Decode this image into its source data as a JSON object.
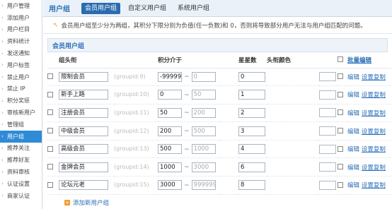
{
  "sidebar": {
    "items": [
      {
        "label": "用户管理",
        "active": false
      },
      {
        "label": "添加用户",
        "active": false
      },
      {
        "label": "用户栏目",
        "active": false
      },
      {
        "label": "资料统计",
        "active": false
      },
      {
        "label": "发送通知",
        "active": false
      },
      {
        "label": "用户标签",
        "active": false
      },
      {
        "label": "禁止用户",
        "active": false
      },
      {
        "label": "禁止 IP",
        "active": false
      },
      {
        "label": "积分奖惩",
        "active": false
      },
      {
        "label": "审核新用户",
        "active": false
      },
      {
        "label": "管理组",
        "active": false
      },
      {
        "label": "用户组",
        "active": true
      },
      {
        "label": "推荐关注",
        "active": false
      },
      {
        "label": "推荐好友",
        "active": false
      },
      {
        "label": "资料审核",
        "active": false
      },
      {
        "label": "认证设置",
        "active": false
      },
      {
        "label": "商家认证",
        "active": false
      }
    ]
  },
  "header": {
    "title": "用户组",
    "tabs": [
      {
        "label": "会员用户组",
        "active": true
      },
      {
        "label": "自定义用户组",
        "active": false
      },
      {
        "label": "系统用户组",
        "active": false
      }
    ]
  },
  "tip": {
    "icon": "hint-icon",
    "text": "会员用户组至少分为两组，其积分下限分别为负值(任一负数)和 0，否则将导致部分用户无法与用户组匹配的问题。"
  },
  "section": {
    "title": "会员用户组",
    "columns": {
      "name": "组头衔",
      "credits": "积分介于",
      "stars": "星星数",
      "color": "头衔颜色",
      "batch": "批量编辑"
    },
    "rows": [
      {
        "name": "限制会员",
        "gid": "(groupid:9)",
        "low": "-99999",
        "high": "0",
        "stars": "0",
        "edit": "编辑",
        "perm": "设置复制"
      },
      {
        "name": "新手上路",
        "gid": "(groupid:10)",
        "low": "0",
        "high": "50",
        "stars": "1",
        "edit": "编辑",
        "perm": "设置复制"
      },
      {
        "name": "注册会员",
        "gid": "(groupid:11)",
        "low": "50",
        "high": "200",
        "stars": "2",
        "edit": "编辑",
        "perm": "设置复制"
      },
      {
        "name": "中级会员",
        "gid": "(groupid:12)",
        "low": "200",
        "high": "500",
        "stars": "3",
        "edit": "编辑",
        "perm": "设置复制"
      },
      {
        "name": "高级会员",
        "gid": "(groupid:13)",
        "low": "500",
        "high": "1000",
        "stars": "4",
        "edit": "编辑",
        "perm": "设置复制"
      },
      {
        "name": "金牌会员",
        "gid": "(groupid:14)",
        "low": "1000",
        "high": "3000",
        "stars": "6",
        "edit": "编辑",
        "perm": "设置复制"
      },
      {
        "name": "论坛元老",
        "gid": "(groupid:15)",
        "low": "3000",
        "high": "999999",
        "stars": "8",
        "edit": "编辑",
        "perm": "设置复制"
      }
    ],
    "add_label": "添加新用户组"
  },
  "colors": {
    "accent": "#2a6fb8",
    "active_nav": "#2f8bd6",
    "add_icon": "#f39c2b"
  }
}
